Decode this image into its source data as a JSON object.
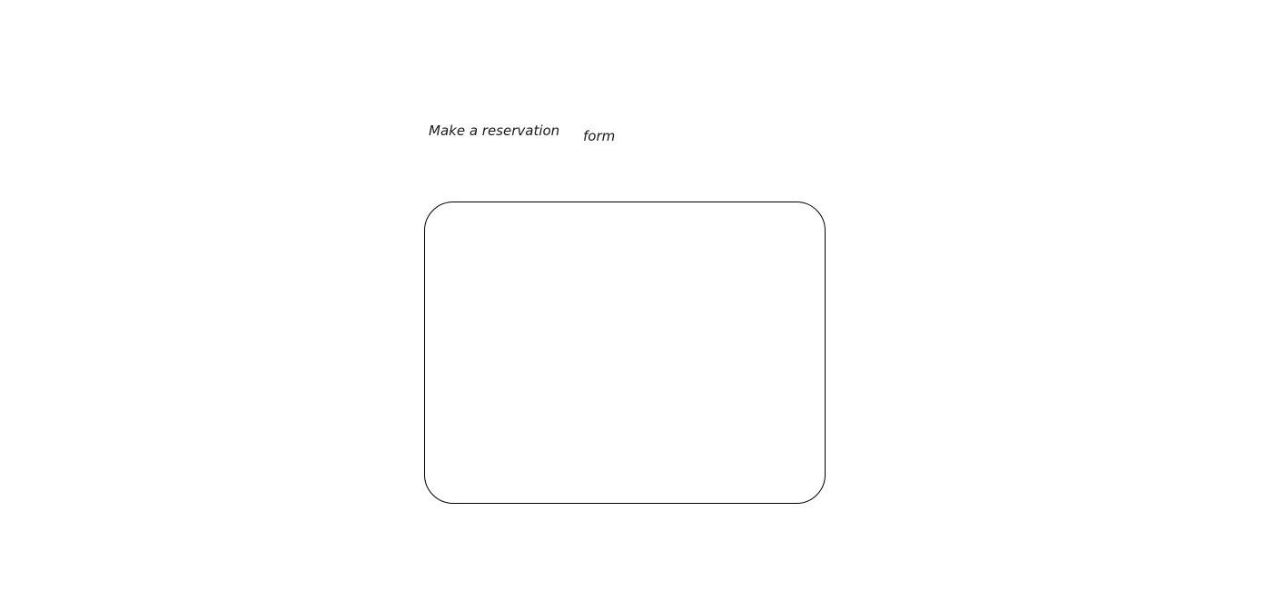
{
  "heading": {
    "title": "Make a reservation",
    "annotation": "form"
  },
  "colors": {
    "background": "#ffffff",
    "border": "#000000",
    "text": "#1a1a1a"
  }
}
